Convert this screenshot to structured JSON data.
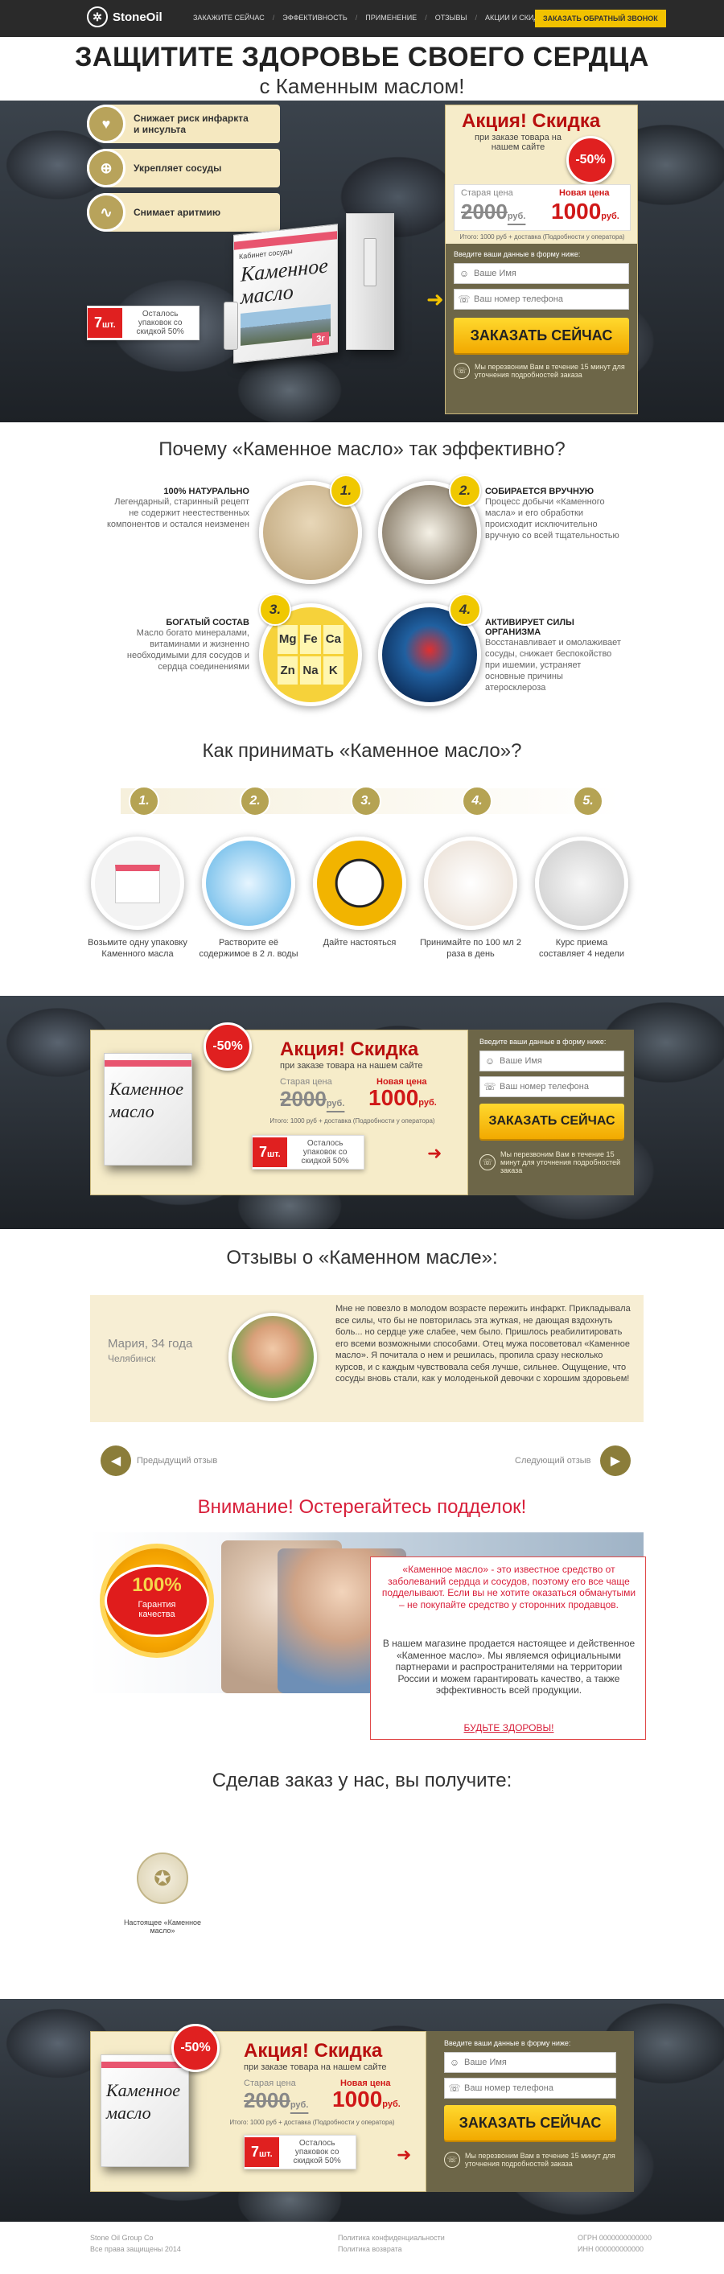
{
  "header": {
    "logo": "StoneOil",
    "nav": [
      "ЗАКАЖИТЕ СЕЙЧАС",
      "ЭФФЕКТИВНОСТЬ",
      "ПРИМЕНЕНИЕ",
      "ОТЗЫВЫ",
      "АКЦИИ И СКИДКИ"
    ],
    "callback": "ЗАКАЗАТЬ ОБРАТНЫЙ ЗВОНОК"
  },
  "hero": {
    "title": "ЗАЩИТИТЕ ЗДОРОВЬЕ СВОЕГО СЕРДЦА",
    "subtitle": "с Каменным маслом!",
    "benefits": [
      "Снижает риск инфаркта и инсульта",
      "Укрепляет сосуды",
      "Снимает аритмию"
    ],
    "product": {
      "top": "Кабинет сосуды",
      "name1": "Каменное",
      "name2": "масло",
      "weight": "3г"
    },
    "stock": {
      "num": "7",
      "unit": "шт.",
      "text": "Осталось упаковок со скидкой 50%"
    },
    "offer": {
      "title": "Акция! Скидка",
      "sub": "при заказе товара на нашем сайте",
      "discount": "-50%",
      "old_label": "Старая цена",
      "old_price": "2000",
      "old_unit": "руб.",
      "new_label": "Новая цена",
      "new_price": "1000",
      "new_unit": "руб.",
      "total": "Итого: 1000 руб + доставка (Подробности у оператора)"
    },
    "form": {
      "intro": "Введите ваши данные в форму ниже:",
      "name_ph": "Ваше Имя",
      "phone_ph": "Ваш номер телефона",
      "button": "ЗАКАЗАТЬ СЕЙЧАС",
      "note": "Мы перезвоним Вам в течение 15 минут для уточнения подробностей заказа"
    }
  },
  "why": {
    "title": "Почему «Каменное масло» так эффективно?",
    "items": [
      {
        "num": "1.",
        "head": "100% НАТУРАЛЬНО",
        "text": "Легендарный, старинный рецепт не содержит неестественных компонентов и остался неизменен"
      },
      {
        "num": "2.",
        "head": "СОБИРАЕТСЯ ВРУЧНУЮ",
        "text": "Процесс добычи «Каменного масла» и его обработки происходит исключительно вручную со всей тщательностью"
      },
      {
        "num": "3.",
        "head": "БОГАТЫЙ СОСТАВ",
        "text": "Масло богато минералами, витаминами и жизненно необходимыми для сосудов и сердца соединениями"
      },
      {
        "num": "4.",
        "head": "АКТИВИРУЕТ СИЛЫ ОРГАНИЗМА",
        "text": "Восстанавливает и омолаживает сосуды, снижает беспокойство при ишемии, устраняет основные причины атеросклероза"
      }
    ],
    "elements": [
      "Mg",
      "Fe",
      "Ca",
      "Zn",
      "Na",
      "K"
    ]
  },
  "how": {
    "title": "Как принимать «Каменное масло»?",
    "steps": [
      {
        "num": "1.",
        "text": "Возьмите одну упаковку Каменного масла"
      },
      {
        "num": "2.",
        "text": "Растворите её содержимое в 2 л. воды"
      },
      {
        "num": "3.",
        "text": "Дайте настояться"
      },
      {
        "num": "4.",
        "text": "Принимайте по 100 мл 2 раза в день"
      },
      {
        "num": "5.",
        "text": "Курс приема составляет 4 недели"
      }
    ]
  },
  "reviews": {
    "title": "Отзывы о «Каменном масле»:",
    "name": "Мария, 34 года",
    "city": "Челябинск",
    "text": "Мне не повезло в молодом возрасте пережить инфаркт. Прикладывала все силы, что бы не повторилась эта жуткая, не дающая вздохнуть боль... но сердце уже слабее, чем было. Пришлось реабилитировать его всеми возможными способами. Отец мужа посоветовал «Каменное масло». Я почитала о нем и решилась, пропила сразу несколько курсов, и с каждым чувствовала себя лучше, сильнее. Ощущение, что сосуды вновь стали, как у молоденькой девочки с хорошим здоровьем!",
    "prev": "Предыдущий отзыв",
    "next": "Следующий отзыв"
  },
  "warning": {
    "title": "Внимание! Остерегайтесь подделок!",
    "seal_big": "100%",
    "seal_small": "Гарантия качества",
    "p1": "«Каменное масло» - это известное средство от заболеваний сердца и сосудов, поэтому его все чаще подделывают. Если вы не хотите оказаться обманутыми – не покупайте средство у сторонних продавцов.",
    "p2": "В нашем магазине продается настоящее и действенное «Каменное масло». Мы являемся официальными партнерами и распространителями на территории России и можем гарантировать качество, а также эффективность всей продукции.",
    "p3": "БУДЬТЕ ЗДОРОВЫ!"
  },
  "receive": {
    "title": "Сделав заказ у нас, вы получите:",
    "item": "Настоящее «Каменное масло»"
  },
  "footer": {
    "company": "Stone Oil Group Co",
    "rights": "Все права защищены 2014",
    "privacy": "Политика конфиденциальности",
    "returns": "Политика возврата",
    "ogrn": "ОГРН 0000000000000",
    "inn": "ИНН 000000000000"
  },
  "colors": {
    "accent": "#f2c200",
    "gold": "#b5a353",
    "red": "#d01818",
    "cream": "#f6ecc9"
  }
}
